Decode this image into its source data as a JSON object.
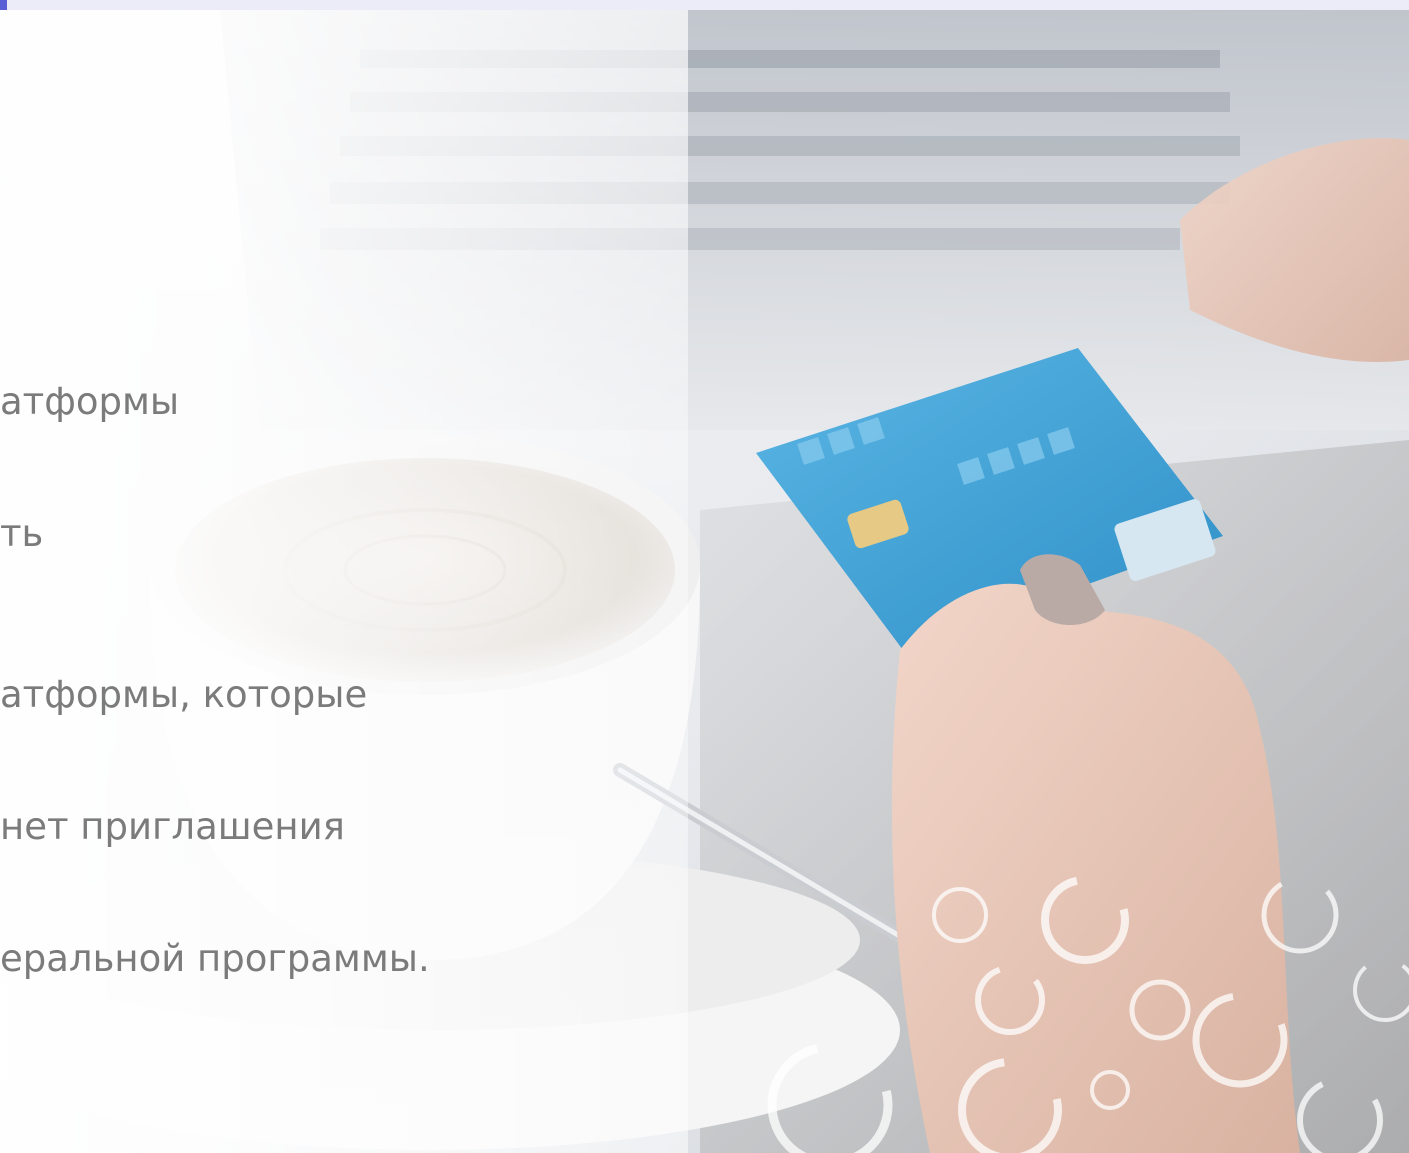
{
  "slide": {
    "text_block_1": {
      "lines": [
        "атформы",
        "ть"
      ]
    },
    "text_block_2": {
      "lines": [
        "атформы, которые",
        "нет приглашения",
        "еральной программы."
      ]
    }
  },
  "colors": {
    "topbar": "#ecebf8",
    "topbar_accent": "#5b5fd6",
    "card_blue": "#3ea3d8",
    "text_gray": "#7b7b7b"
  },
  "icons": [
    "payment-card-icon",
    "coffee-cup-icon",
    "laptop-keyboard-icon",
    "decorative-rings-icon"
  ]
}
